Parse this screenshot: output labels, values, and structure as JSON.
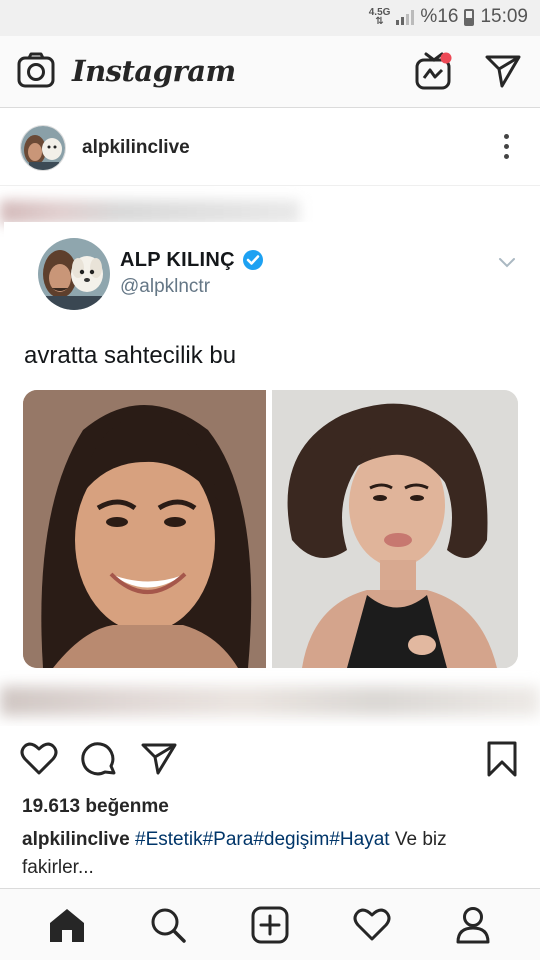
{
  "status_bar": {
    "network": "4.5G",
    "battery_text": "%16",
    "time": "15:09"
  },
  "header": {
    "app_name": "Instagram",
    "left_icon": "camera-icon",
    "right_icons": [
      "igtv-icon",
      "direct-message-icon"
    ],
    "notification_dot_color": "#ed4956"
  },
  "post": {
    "username": "alpkilinclive",
    "menu_icon": "more-vertical-icon",
    "tweet": {
      "name": "ALP KILINÇ",
      "handle": "@alpklnctr",
      "verified_icon": "verified-badge-icon",
      "text": "avratta sahtecilik bu",
      "photo_count": 2
    },
    "actions": {
      "like_icon": "heart-icon",
      "comment_icon": "comment-icon",
      "share_icon": "share-icon",
      "save_icon": "bookmark-icon"
    },
    "likes": "19.613 beğenme",
    "caption": {
      "username": "alpkilinclive",
      "tags": [
        "#Estetik",
        "#Para",
        "#degişim",
        "#Hayat"
      ],
      "text_before_break": "Ve biz",
      "text_after_break": "fakirler..."
    }
  },
  "bottom_nav": {
    "items": [
      "home-icon",
      "search-icon",
      "add-post-icon",
      "activity-heart-icon",
      "profile-icon"
    ],
    "active": "home-icon"
  },
  "colors": {
    "header_bg": "#fafafa",
    "status_bg": "#f0f0f0",
    "text": "#262626",
    "hashtag": "#003569",
    "twitter_blue": "#1da1f2",
    "handle_gray": "#657786"
  }
}
